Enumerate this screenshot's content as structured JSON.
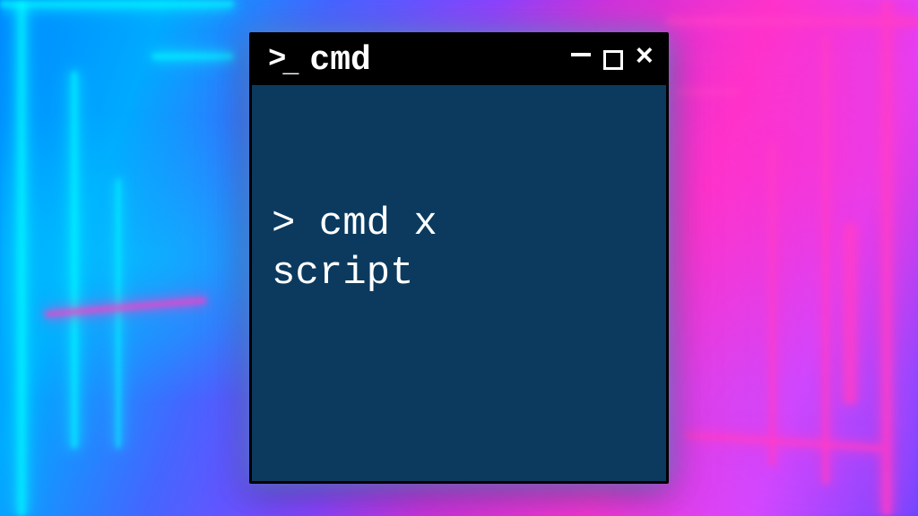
{
  "window": {
    "icon_glyph": ">_",
    "title": "cmd"
  },
  "terminal": {
    "prompt_symbol": ">",
    "command_line1": "> cmd x",
    "command_line2": "script"
  },
  "colors": {
    "terminal_bg": "#0b3a5e",
    "titlebar_bg": "#000000",
    "text": "#ffffff"
  }
}
